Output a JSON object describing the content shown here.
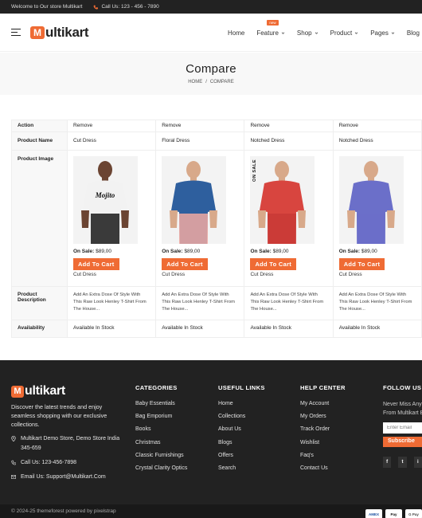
{
  "topbar": {
    "welcome": "Welcome to Our store Multikart",
    "phone": "Call Us: 123 - 456 - 7890"
  },
  "header": {
    "logo_letter": "M",
    "logo_text": "ultikart",
    "nav": [
      {
        "label": "Home",
        "has_dropdown": false
      },
      {
        "label": "Feature",
        "has_dropdown": true,
        "badge": "new"
      },
      {
        "label": "Shop",
        "has_dropdown": true
      },
      {
        "label": "Product",
        "has_dropdown": true
      },
      {
        "label": "Pages",
        "has_dropdown": true
      },
      {
        "label": "Blog",
        "has_dropdown": false
      }
    ]
  },
  "page": {
    "title": "Compare",
    "breadcrumb_home": "HOME",
    "breadcrumb_sep": "/",
    "breadcrumb_current": "COMPARE"
  },
  "compare": {
    "labels": {
      "action": "Action",
      "name": "Product Name",
      "image": "Product Image",
      "description": "Product Description",
      "availability": "Availability"
    },
    "products": [
      {
        "remove": "Remove",
        "name": "Cut Dress",
        "sale_label": "On Sale:",
        "price": "$89,00",
        "add_to_cart": "Add To Cart",
        "variant": "Cut Dress",
        "description": "Add An Extra Dose Of Style With This Raw Look Henley T-Shirt From The House...",
        "availability": "Available In Stock",
        "tag": "",
        "colors": {
          "shirt": "#f2f2f2",
          "bottom": "#1a1a1a",
          "skin": "#6b4432"
        },
        "image_text": "Mojito"
      },
      {
        "remove": "Remove",
        "name": "Floral Dress",
        "sale_label": "On Sale:",
        "price": "$89,00",
        "add_to_cart": "Add To Cart",
        "variant": "Cut Dress",
        "description": "Add An Extra Dose Of Style With This Raw Look Henley T-Shirt From The House...",
        "availability": "Available In Stock",
        "tag": "",
        "colors": {
          "shirt": "#2e5f9e",
          "bottom": "#f0a9a1",
          "skin": "#d8a98a"
        }
      },
      {
        "remove": "Remove",
        "name": "Notched Dress",
        "sale_label": "On Sale:",
        "price": "$89,00",
        "add_to_cart": "Add To Cart",
        "variant": "Cut Dress",
        "description": "Add An Extra Dose Of Style With This Raw Look Henley T-Shirt From The House...",
        "availability": "Available In Stock",
        "tag": "ON SALE",
        "colors": {
          "shirt": "#d8453f",
          "bottom": "#c93a36",
          "skin": "#d8a98a"
        }
      },
      {
        "remove": "Remove",
        "name": "Notched Dress",
        "sale_label": "On Sale:",
        "price": "$89,00",
        "add_to_cart": "Add To Cart",
        "variant": "Cut Dress",
        "description": "Add An Extra Dose Of Style With This Raw Look Henley T-Shirt From The House...",
        "availability": "Available In Stock",
        "tag": "",
        "colors": {
          "shirt": "#6b6fc9",
          "bottom": "#6b6fc9",
          "skin": "#d8a98a"
        }
      }
    ]
  },
  "footer": {
    "about": "Discover the latest trends and enjoy seamless shopping with our exclusive collections.",
    "address": "Multikart Demo Store, Demo Store India 345-659",
    "phone": "Call Us: 123-456-7898",
    "email": "Email Us: Support@Multikart.Com",
    "categories": {
      "title": "CATEGORIES",
      "items": [
        "Baby Essentials",
        "Bag Emporium",
        "Books",
        "Christmas",
        "Classic Furnishings",
        "Crystal Clarity Optics"
      ]
    },
    "useful_links": {
      "title": "USEFUL LINKS",
      "items": [
        "Home",
        "Collections",
        "About Us",
        "Blogs",
        "Offers",
        "Search"
      ]
    },
    "help_center": {
      "title": "HELP CENTER",
      "items": [
        "My Account",
        "My Orders",
        "Track Order",
        "Wishlist",
        "Faq's",
        "Contact Us"
      ]
    },
    "follow": {
      "title": "FOLLOW US",
      "text": "Never Miss Anything From Multikart By Signing Up To Our Newsletter.",
      "email_placeholder": "Enter Email",
      "subscribe": "Subscribe",
      "social": [
        "f",
        "t",
        "i"
      ]
    },
    "copyright": "© 2024-25 themeforest powered by pixelstrap",
    "payments": [
      "AMEX",
      "Pay",
      "G Pay"
    ]
  },
  "theme": {
    "accent": "#ef6b34",
    "dark": "#222222"
  }
}
